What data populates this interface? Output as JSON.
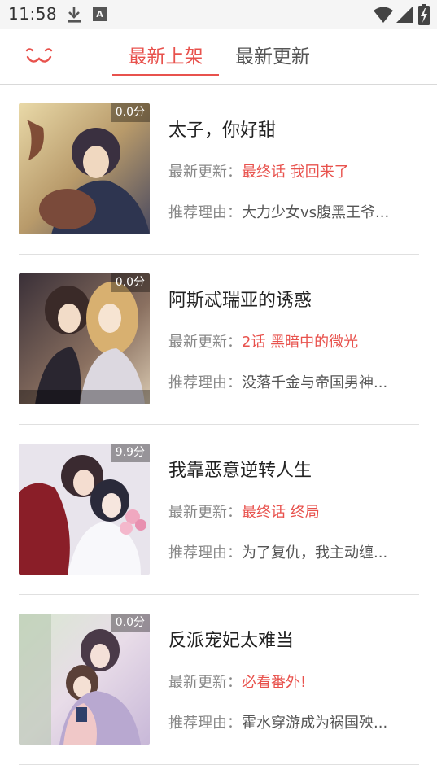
{
  "status_bar": {
    "time": "11:58",
    "icons": [
      "download-icon",
      "a-notification-icon",
      "wifi-icon",
      "signal-icon",
      "battery-icon"
    ]
  },
  "header": {
    "logo": "logo-icon",
    "tabs": [
      {
        "label": "最新上架",
        "active": true
      },
      {
        "label": "最新更新",
        "active": false
      }
    ]
  },
  "labels": {
    "update": "最新更新：",
    "reason": "推荐理由："
  },
  "colors": {
    "accent": "#e8524d",
    "divider": "#e0e0e0"
  },
  "items": [
    {
      "title": "太子，你好甜",
      "score": "0.0分",
      "update": "最终话 我回来了",
      "reason": "大力少女vs腹黑王爷..."
    },
    {
      "title": "阿斯忒瑞亚的诱惑",
      "score": "0.0分",
      "update": "2话 黑暗中的微光",
      "reason": "没落千金与帝国男神..."
    },
    {
      "title": "我靠恶意逆转人生",
      "score": "9.9分",
      "update": "最终话 终局",
      "reason": "为了复仇，我主动缠..."
    },
    {
      "title": "反派宠妃太难当",
      "score": "0.0分",
      "update": "必看番外!",
      "reason": "霍水穿游成为祸国殃..."
    }
  ]
}
